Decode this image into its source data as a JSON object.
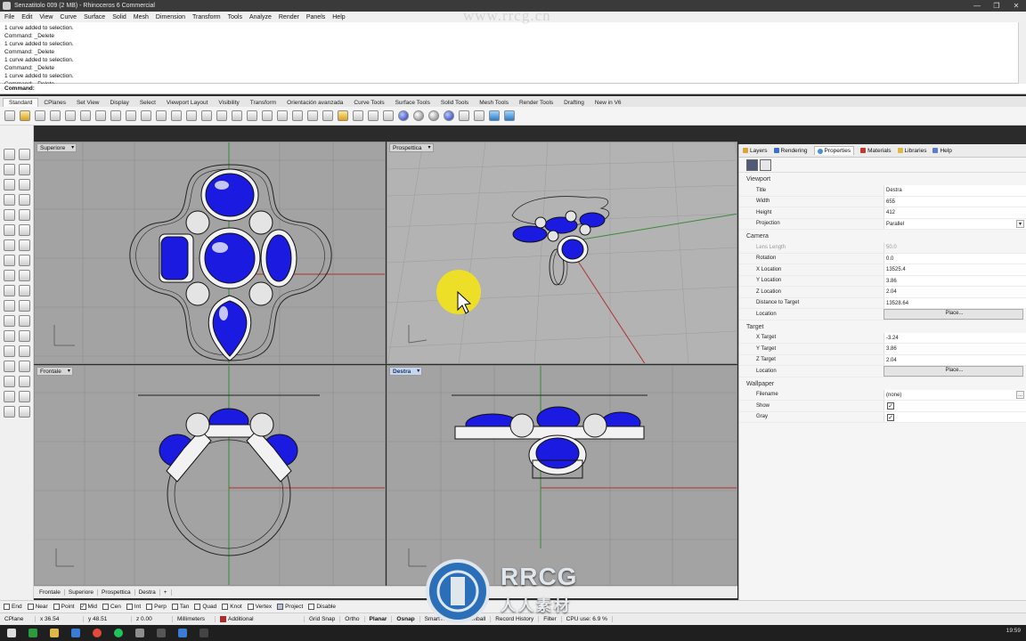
{
  "window": {
    "title": "Senzatitolo 009 (2 MB) - Rhinoceros 6 Commercial",
    "controls": [
      "—",
      "❐",
      "✕"
    ]
  },
  "menu": [
    "File",
    "Edit",
    "View",
    "Curve",
    "Surface",
    "Solid",
    "Mesh",
    "Dimension",
    "Transform",
    "Tools",
    "Analyze",
    "Render",
    "Panels",
    "Help"
  ],
  "command_history": [
    "1 curve added to selection.",
    "Command: _Delete",
    "1 curve added to selection.",
    "Command: _Delete",
    "1 curve added to selection.",
    "Command: _Delete",
    "1 curve added to selection.",
    "Command: _Delete"
  ],
  "command_prompt": "Command:",
  "toolbar_tabs": [
    "Standard",
    "CPlanes",
    "Set View",
    "Display",
    "Select",
    "Viewport Layout",
    "Visibility",
    "Transform",
    "Orientación avanzada",
    "Curve Tools",
    "Surface Tools",
    "Solid Tools",
    "Mesh Tools",
    "Render Tools",
    "Drafting",
    "New in V6"
  ],
  "viewports": {
    "top": "Superiore",
    "persp": "Prospettica",
    "front": "Frontale",
    "right": "Destra"
  },
  "viewport_tabs": [
    "Frontale",
    "Superiore",
    "Prospettica",
    "Destra",
    "+"
  ],
  "panel": {
    "tabs": [
      "Layers",
      "Rendering",
      "Properties",
      "Materials",
      "Libraries",
      "Help"
    ],
    "viewport_section": "Viewport",
    "title_label": "Title",
    "title_value": "Destra",
    "width_label": "Width",
    "width_value": "655",
    "height_label": "Height",
    "height_value": "412",
    "projection_label": "Projection",
    "projection_value": "Parallel",
    "camera_section": "Camera",
    "lens_label": "Lens Length",
    "lens_value": "50.0",
    "rotation_label": "Rotation",
    "rotation_value": "0.0",
    "xloc_label": "X Location",
    "xloc_value": "13525.4",
    "yloc_label": "Y Location",
    "yloc_value": "3.86",
    "zloc_label": "Z Location",
    "zloc_value": "2.04",
    "dist_label": "Distance to Target",
    "dist_value": "13528.64",
    "cam_location_label": "Location",
    "place_button": "Place...",
    "target_section": "Target",
    "xt_label": "X Target",
    "xt_value": "-3.24",
    "yt_label": "Y Target",
    "yt_value": "3.86",
    "zt_label": "Z Target",
    "zt_value": "2.04",
    "tgt_location_label": "Location",
    "wallpaper_section": "Wallpaper",
    "filename_label": "Filename",
    "filename_value": "(none)",
    "browse_button": "...",
    "show_label": "Show",
    "show_checked": true,
    "gray_label": "Gray",
    "gray_checked": true
  },
  "osnap": [
    {
      "label": "End",
      "checked": false
    },
    {
      "label": "Near",
      "checked": false
    },
    {
      "label": "Point",
      "checked": false
    },
    {
      "label": "Mid",
      "checked": true
    },
    {
      "label": "Cen",
      "checked": false
    },
    {
      "label": "Int",
      "checked": false
    },
    {
      "label": "Perp",
      "checked": false
    },
    {
      "label": "Tan",
      "checked": false
    },
    {
      "label": "Quad",
      "checked": false
    },
    {
      "label": "Knot",
      "checked": false
    },
    {
      "label": "Vertex",
      "checked": false
    },
    {
      "label": "Project",
      "checked": false
    },
    {
      "label": "Disable",
      "checked": false
    }
  ],
  "status": {
    "cplane": "CPlane",
    "x": "x 36.54",
    "y": "y 48.51",
    "z": "z 0.00",
    "units": "Millimeters",
    "layer": "Additional",
    "grid_snap": "Grid Snap",
    "ortho": "Ortho",
    "planar": "Planar",
    "osnap": "Osnap",
    "smarttrack": "SmartTrack",
    "gumball": "Gumball",
    "history": "Record History",
    "filter": "Filter",
    "cpu": "CPU use: 6.9 %"
  },
  "colors": {
    "gem_blue": "#1a1ae0",
    "viewport_bg": "#a3a3a3",
    "persp_bg": "#b3b3b3",
    "highlight": "#f2e21c"
  },
  "taskbar": {
    "clock": "19:59"
  },
  "watermark": {
    "url": "www.rrcg.cn",
    "brand": "RRCG",
    "brand_cn": "人人素材"
  }
}
